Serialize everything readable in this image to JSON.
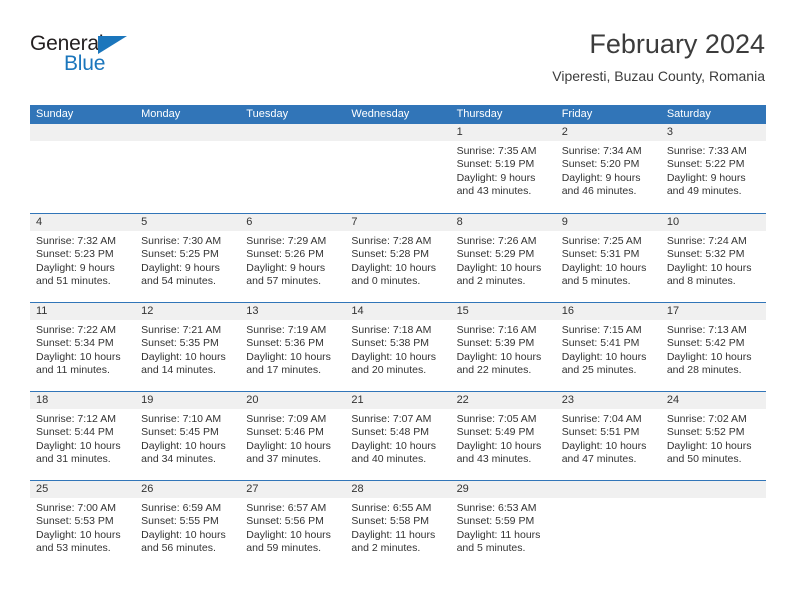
{
  "logo": {
    "word_one": "General",
    "word_two": "Blue",
    "triangle_color": "#1b76bc"
  },
  "header": {
    "title": "February 2024",
    "subtitle": "Viperesti, Buzau County, Romania"
  },
  "theme": {
    "header_blue": "#3175b8",
    "day_band_gray": "#f0f0f0",
    "text": "#333333"
  },
  "weekdays": [
    "Sunday",
    "Monday",
    "Tuesday",
    "Wednesday",
    "Thursday",
    "Friday",
    "Saturday"
  ],
  "weeks": [
    [
      {
        "empty": true
      },
      {
        "empty": true
      },
      {
        "empty": true
      },
      {
        "empty": true
      },
      {
        "day": "1",
        "sunrise": "Sunrise: 7:35 AM",
        "sunset": "Sunset: 5:19 PM",
        "daylight1": "Daylight: 9 hours",
        "daylight2": "and 43 minutes."
      },
      {
        "day": "2",
        "sunrise": "Sunrise: 7:34 AM",
        "sunset": "Sunset: 5:20 PM",
        "daylight1": "Daylight: 9 hours",
        "daylight2": "and 46 minutes."
      },
      {
        "day": "3",
        "sunrise": "Sunrise: 7:33 AM",
        "sunset": "Sunset: 5:22 PM",
        "daylight1": "Daylight: 9 hours",
        "daylight2": "and 49 minutes."
      }
    ],
    [
      {
        "day": "4",
        "sunrise": "Sunrise: 7:32 AM",
        "sunset": "Sunset: 5:23 PM",
        "daylight1": "Daylight: 9 hours",
        "daylight2": "and 51 minutes."
      },
      {
        "day": "5",
        "sunrise": "Sunrise: 7:30 AM",
        "sunset": "Sunset: 5:25 PM",
        "daylight1": "Daylight: 9 hours",
        "daylight2": "and 54 minutes."
      },
      {
        "day": "6",
        "sunrise": "Sunrise: 7:29 AM",
        "sunset": "Sunset: 5:26 PM",
        "daylight1": "Daylight: 9 hours",
        "daylight2": "and 57 minutes."
      },
      {
        "day": "7",
        "sunrise": "Sunrise: 7:28 AM",
        "sunset": "Sunset: 5:28 PM",
        "daylight1": "Daylight: 10 hours",
        "daylight2": "and 0 minutes."
      },
      {
        "day": "8",
        "sunrise": "Sunrise: 7:26 AM",
        "sunset": "Sunset: 5:29 PM",
        "daylight1": "Daylight: 10 hours",
        "daylight2": "and 2 minutes."
      },
      {
        "day": "9",
        "sunrise": "Sunrise: 7:25 AM",
        "sunset": "Sunset: 5:31 PM",
        "daylight1": "Daylight: 10 hours",
        "daylight2": "and 5 minutes."
      },
      {
        "day": "10",
        "sunrise": "Sunrise: 7:24 AM",
        "sunset": "Sunset: 5:32 PM",
        "daylight1": "Daylight: 10 hours",
        "daylight2": "and 8 minutes."
      }
    ],
    [
      {
        "day": "11",
        "sunrise": "Sunrise: 7:22 AM",
        "sunset": "Sunset: 5:34 PM",
        "daylight1": "Daylight: 10 hours",
        "daylight2": "and 11 minutes."
      },
      {
        "day": "12",
        "sunrise": "Sunrise: 7:21 AM",
        "sunset": "Sunset: 5:35 PM",
        "daylight1": "Daylight: 10 hours",
        "daylight2": "and 14 minutes."
      },
      {
        "day": "13",
        "sunrise": "Sunrise: 7:19 AM",
        "sunset": "Sunset: 5:36 PM",
        "daylight1": "Daylight: 10 hours",
        "daylight2": "and 17 minutes."
      },
      {
        "day": "14",
        "sunrise": "Sunrise: 7:18 AM",
        "sunset": "Sunset: 5:38 PM",
        "daylight1": "Daylight: 10 hours",
        "daylight2": "and 20 minutes."
      },
      {
        "day": "15",
        "sunrise": "Sunrise: 7:16 AM",
        "sunset": "Sunset: 5:39 PM",
        "daylight1": "Daylight: 10 hours",
        "daylight2": "and 22 minutes."
      },
      {
        "day": "16",
        "sunrise": "Sunrise: 7:15 AM",
        "sunset": "Sunset: 5:41 PM",
        "daylight1": "Daylight: 10 hours",
        "daylight2": "and 25 minutes."
      },
      {
        "day": "17",
        "sunrise": "Sunrise: 7:13 AM",
        "sunset": "Sunset: 5:42 PM",
        "daylight1": "Daylight: 10 hours",
        "daylight2": "and 28 minutes."
      }
    ],
    [
      {
        "day": "18",
        "sunrise": "Sunrise: 7:12 AM",
        "sunset": "Sunset: 5:44 PM",
        "daylight1": "Daylight: 10 hours",
        "daylight2": "and 31 minutes."
      },
      {
        "day": "19",
        "sunrise": "Sunrise: 7:10 AM",
        "sunset": "Sunset: 5:45 PM",
        "daylight1": "Daylight: 10 hours",
        "daylight2": "and 34 minutes."
      },
      {
        "day": "20",
        "sunrise": "Sunrise: 7:09 AM",
        "sunset": "Sunset: 5:46 PM",
        "daylight1": "Daylight: 10 hours",
        "daylight2": "and 37 minutes."
      },
      {
        "day": "21",
        "sunrise": "Sunrise: 7:07 AM",
        "sunset": "Sunset: 5:48 PM",
        "daylight1": "Daylight: 10 hours",
        "daylight2": "and 40 minutes."
      },
      {
        "day": "22",
        "sunrise": "Sunrise: 7:05 AM",
        "sunset": "Sunset: 5:49 PM",
        "daylight1": "Daylight: 10 hours",
        "daylight2": "and 43 minutes."
      },
      {
        "day": "23",
        "sunrise": "Sunrise: 7:04 AM",
        "sunset": "Sunset: 5:51 PM",
        "daylight1": "Daylight: 10 hours",
        "daylight2": "and 47 minutes."
      },
      {
        "day": "24",
        "sunrise": "Sunrise: 7:02 AM",
        "sunset": "Sunset: 5:52 PM",
        "daylight1": "Daylight: 10 hours",
        "daylight2": "and 50 minutes."
      }
    ],
    [
      {
        "day": "25",
        "sunrise": "Sunrise: 7:00 AM",
        "sunset": "Sunset: 5:53 PM",
        "daylight1": "Daylight: 10 hours",
        "daylight2": "and 53 minutes."
      },
      {
        "day": "26",
        "sunrise": "Sunrise: 6:59 AM",
        "sunset": "Sunset: 5:55 PM",
        "daylight1": "Daylight: 10 hours",
        "daylight2": "and 56 minutes."
      },
      {
        "day": "27",
        "sunrise": "Sunrise: 6:57 AM",
        "sunset": "Sunset: 5:56 PM",
        "daylight1": "Daylight: 10 hours",
        "daylight2": "and 59 minutes."
      },
      {
        "day": "28",
        "sunrise": "Sunrise: 6:55 AM",
        "sunset": "Sunset: 5:58 PM",
        "daylight1": "Daylight: 11 hours",
        "daylight2": "and 2 minutes."
      },
      {
        "day": "29",
        "sunrise": "Sunrise: 6:53 AM",
        "sunset": "Sunset: 5:59 PM",
        "daylight1": "Daylight: 11 hours",
        "daylight2": "and 5 minutes."
      },
      {
        "empty": true
      },
      {
        "empty": true
      }
    ]
  ]
}
